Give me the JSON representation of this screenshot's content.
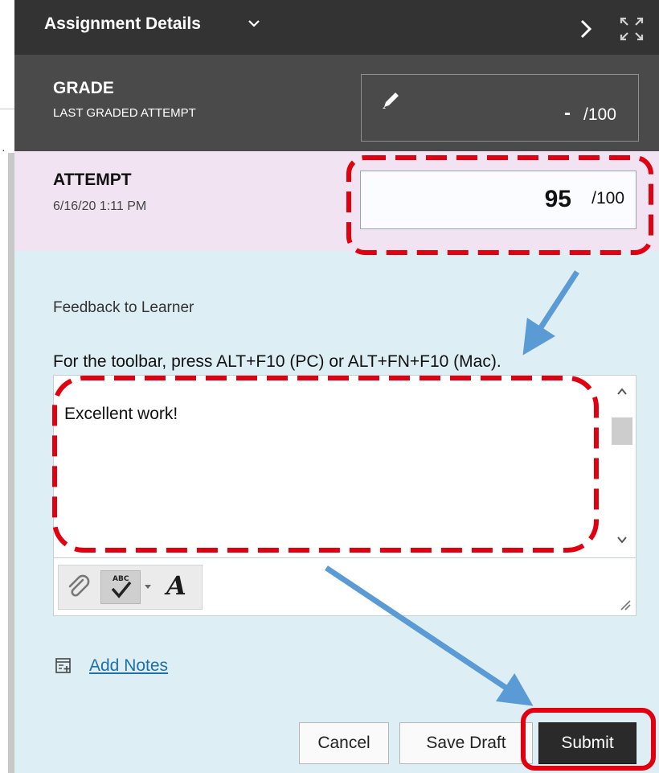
{
  "header": {
    "title": "Assignment Details",
    "chevron_icon": "chevron-down-icon",
    "next_icon": "chevron-right-icon",
    "expand_icon": "expand-icon"
  },
  "grade": {
    "label": "GRADE",
    "sublabel": "LAST GRADED ATTEMPT",
    "value": "-",
    "max": "/100",
    "edit_icon": "pencil-icon"
  },
  "attempt": {
    "label": "ATTEMPT",
    "date": "6/16/20 1:11 PM",
    "score": "95",
    "max": "/100"
  },
  "feedback": {
    "label": "Feedback to Learner",
    "toolbar_hint": "For the toolbar, press ALT+F10 (PC) or ALT+FN+F10 (Mac).",
    "text": "Excellent work!",
    "toolbar": {
      "attach_icon": "paperclip-icon",
      "spellcheck_icon": "spellcheck-icon",
      "font_icon": "font-icon",
      "font_glyph": "A"
    }
  },
  "notes": {
    "link": "Add Notes",
    "icon": "notes-icon"
  },
  "actions": {
    "cancel": "Cancel",
    "save_draft": "Save Draft",
    "submit": "Submit"
  },
  "colors": {
    "header_bg": "#333333",
    "grade_bg": "#4a4a4a",
    "attempt_bg": "#f1e3f1",
    "panel_bg": "#ddeef4",
    "link": "#1f6fa8",
    "highlight_red": "#e0000f",
    "arrow_blue": "#5b9bd5"
  }
}
